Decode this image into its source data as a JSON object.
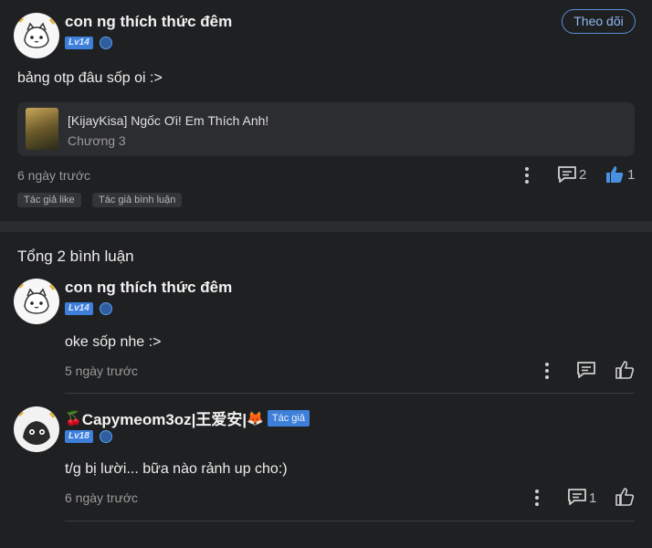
{
  "post": {
    "username": "con ng thích thức đêm",
    "level": "Lv14",
    "follow_label": "Theo dõi",
    "content": "bảng otp đâu sốp oi :>",
    "book_title": "[KijayKisa] Ngốc Ơi! Em Thích Anh!",
    "book_chapter": "Chương 3",
    "time": "6 ngày trước",
    "comment_count": "2",
    "like_count": "1",
    "tags": [
      "Tác giả like",
      "Tác giả bình luận"
    ]
  },
  "comments_header": "Tổng 2 bình luận",
  "comments": [
    {
      "username": "con ng thích thức đêm",
      "level": "Lv14",
      "content": "oke sốp nhe :>",
      "time": "5 ngày trước"
    },
    {
      "username_prefix": "🍒",
      "username": "Capymeom3oz|王爱安|",
      "username_suffix": "🦊",
      "badge": "Tác giả",
      "level": "Lv18",
      "content": "t/g bị lười... bữa nào rảnh up cho:)",
      "time": "6 ngày trước",
      "reply_count": "1"
    }
  ],
  "colors": {
    "background": "#1f2022",
    "accent": "#3d7fd9",
    "like_active": "#4a90e2"
  },
  "icons": [
    "more-vertical-icon",
    "comment-icon",
    "thumbs-up-icon",
    "microphone-icon"
  ]
}
